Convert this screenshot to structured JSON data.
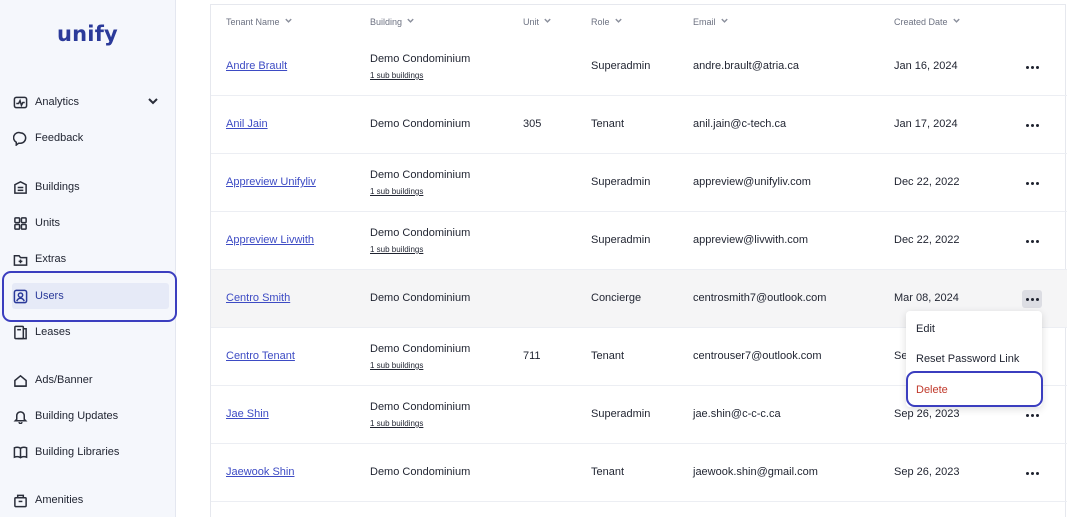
{
  "app": {
    "logo": "unify"
  },
  "sidebar": {
    "items": [
      {
        "label": "Analytics",
        "icon": "analytics-icon",
        "expandable": true
      },
      {
        "label": "Feedback",
        "icon": "feedback-icon"
      },
      {
        "label": "Buildings",
        "icon": "buildings-icon"
      },
      {
        "label": "Units",
        "icon": "units-icon"
      },
      {
        "label": "Extras",
        "icon": "extras-icon"
      },
      {
        "label": "Users",
        "icon": "users-icon",
        "active": true
      },
      {
        "label": "Leases",
        "icon": "leases-icon"
      },
      {
        "label": "Ads/Banner",
        "icon": "ads-icon"
      },
      {
        "label": "Building Updates",
        "icon": "bell-icon"
      },
      {
        "label": "Building Libraries",
        "icon": "book-icon"
      },
      {
        "label": "Amenities",
        "icon": "amenities-icon"
      }
    ]
  },
  "table": {
    "columns": [
      "Tenant Name",
      "Building",
      "Unit",
      "Role",
      "Email",
      "Created Date"
    ],
    "rows": [
      {
        "name": "Andre Brault",
        "building": "Demo Condominium",
        "sub": "1 sub buildings",
        "unit": "",
        "role": "Superadmin",
        "email": "andre.brault@atria.ca",
        "date": "Jan 16, 2024"
      },
      {
        "name": "Anil Jain",
        "building": "Demo Condominium",
        "sub": "",
        "unit": "305",
        "role": "Tenant",
        "email": "anil.jain@c-tech.ca",
        "date": "Jan 17, 2024"
      },
      {
        "name": "Appreview Unifyliv",
        "building": "Demo Condominium",
        "sub": "1 sub buildings",
        "unit": "",
        "role": "Superadmin",
        "email": "appreview@unifyliv.com",
        "date": "Dec 22, 2022"
      },
      {
        "name": "Appreview Livwith",
        "building": "Demo Condominium",
        "sub": "1 sub buildings",
        "unit": "",
        "role": "Superadmin",
        "email": "appreview@livwith.com",
        "date": "Dec 22, 2022"
      },
      {
        "name": "Centro Smith",
        "building": "Demo Condominium",
        "sub": "",
        "unit": "",
        "role": "Concierge",
        "email": "centrosmith7@outlook.com",
        "date": "Mar 08, 2024"
      },
      {
        "name": "Centro Tenant",
        "building": "Demo Condominium",
        "sub": "1 sub buildings",
        "unit": "711",
        "role": "Tenant",
        "email": "centrouser7@outlook.com",
        "date": "Se"
      },
      {
        "name": "Jae Shin",
        "building": "Demo Condominium",
        "sub": "1 sub buildings",
        "unit": "",
        "role": "Superadmin",
        "email": "jae.shin@c-c-c.ca",
        "date": "Sep 26, 2023"
      },
      {
        "name": "Jaewook Shin",
        "building": "Demo Condominium",
        "sub": "",
        "unit": "",
        "role": "Tenant",
        "email": "jaewook.shin@gmail.com",
        "date": "Sep 26, 2023"
      }
    ]
  },
  "row_menu": {
    "items": [
      "Edit",
      "Reset Password Link",
      "Delete"
    ]
  },
  "colors": {
    "accent": "#2b3a9a",
    "link": "#3d4bc4",
    "delete": "#c0392b",
    "highlight": "#3b3ebf"
  }
}
